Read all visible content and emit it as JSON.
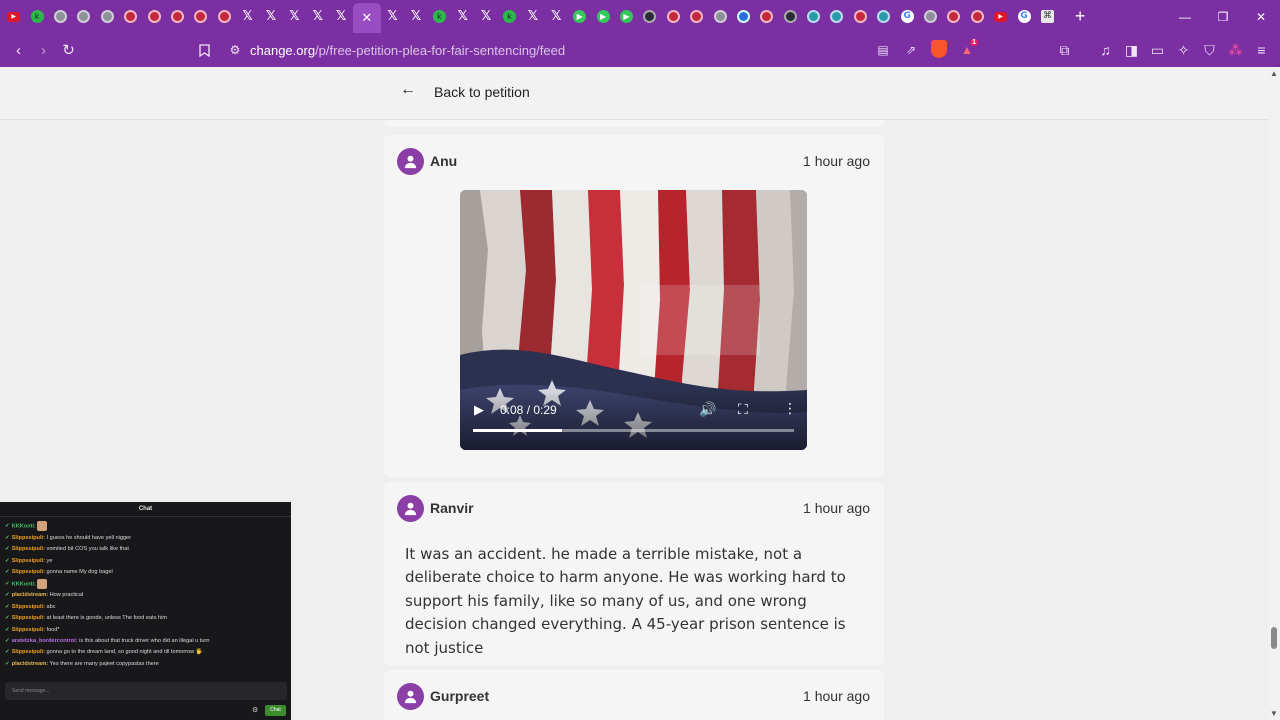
{
  "browser": {
    "tab_icons": [
      "youtube-icon",
      "kick-icon",
      "globe-icon",
      "globe-icon",
      "globe-icon",
      "red-circle-icon",
      "red-circle-icon",
      "red-circle-icon",
      "red-circle-icon",
      "red-circle-icon",
      "x-icon",
      "x-icon",
      "x-icon",
      "x-icon",
      "x-icon",
      "close-icon",
      "x-icon",
      "x-icon",
      "kick-icon",
      "x-icon",
      "x-icon",
      "kick-icon",
      "x-icon",
      "x-icon",
      "play-icon",
      "play-icon",
      "play-icon",
      "blank-icon",
      "red-circle-icon",
      "red-circle-icon",
      "globe-icon",
      "blue-circle-icon",
      "red-circle-icon",
      "dark-circle-icon",
      "teal-circle-icon",
      "teal-circle-icon",
      "red-circle-icon",
      "teal-circle-icon",
      "google-icon",
      "globe-icon",
      "red-circle-icon",
      "red-circle-icon",
      "youtube-icon",
      "google-icon",
      "mesh-icon"
    ],
    "active_tab_index": 15,
    "new_tab_label": "+",
    "url_host": "change.org",
    "url_path": "/p/free-petition-plea-for-fair-sentencing/feed",
    "brave_badge": "1",
    "accent": "#7b2fa3"
  },
  "page": {
    "back_label": "Back to petition",
    "posts": [
      {
        "author": "Anu",
        "time": "1 hour ago",
        "video": {
          "current": "0:08",
          "duration": "0:29",
          "time_display": "0:08 / 0:29",
          "progress": 0.276
        }
      },
      {
        "author": "Ranvir",
        "time": "1 hour ago",
        "text": "It was an accident. he made a terrible mistake, not a deliberate choice to harm anyone. He was working hard to support his family, like so many of us, and one wrong decision changed everything. A 45-year prison sentence is not justice"
      },
      {
        "author": "Gurpreet",
        "time": "1 hour ago"
      }
    ],
    "avatar_color": "#8b3ea6"
  },
  "chat": {
    "title": "Chat",
    "messages": [
      {
        "user": "KKKonti:",
        "color": "#49c16b",
        "text": "",
        "emote": true
      },
      {
        "user": "Slippssipuli:",
        "color": "#f0a020",
        "text": "I guess he should have yell nigger"
      },
      {
        "user": "Slippssipuli:",
        "color": "#f0a020",
        "text": "vomited bit COS you talk like that"
      },
      {
        "user": "Slippssipuli:",
        "color": "#f0a020",
        "text": "ye"
      },
      {
        "user": "Slippssipuli:",
        "color": "#f0a020",
        "text": "gonna name My dog bagel"
      },
      {
        "user": "KKKonti:",
        "color": "#49c16b",
        "text": "",
        "emote": true
      },
      {
        "user": "placidstream:",
        "color": "#e8b84a",
        "text": "How practical"
      },
      {
        "user": "Slippssipuli:",
        "color": "#f0a020",
        "text": "abc"
      },
      {
        "user": "Slippssipuli:",
        "color": "#f0a020",
        "text": "at least there is goode, unless The food eats him"
      },
      {
        "user": "Slippssipuli:",
        "color": "#f0a020",
        "text": "food*"
      },
      {
        "user": "aratetzka_bordercontrol:",
        "color": "#b86fe0",
        "text": "is this about that truck driver who did an illegal u turn"
      },
      {
        "user": "Slippssipuli:",
        "color": "#f0a020",
        "text": "gonna go to the dream land, so good night and till tomorrow 🖐"
      },
      {
        "user": "placidstream:",
        "color": "#e8b84a",
        "text": "Yes there are many pajeet copypastas there"
      }
    ],
    "input_placeholder": "Send message...",
    "send_label": "Chat"
  }
}
